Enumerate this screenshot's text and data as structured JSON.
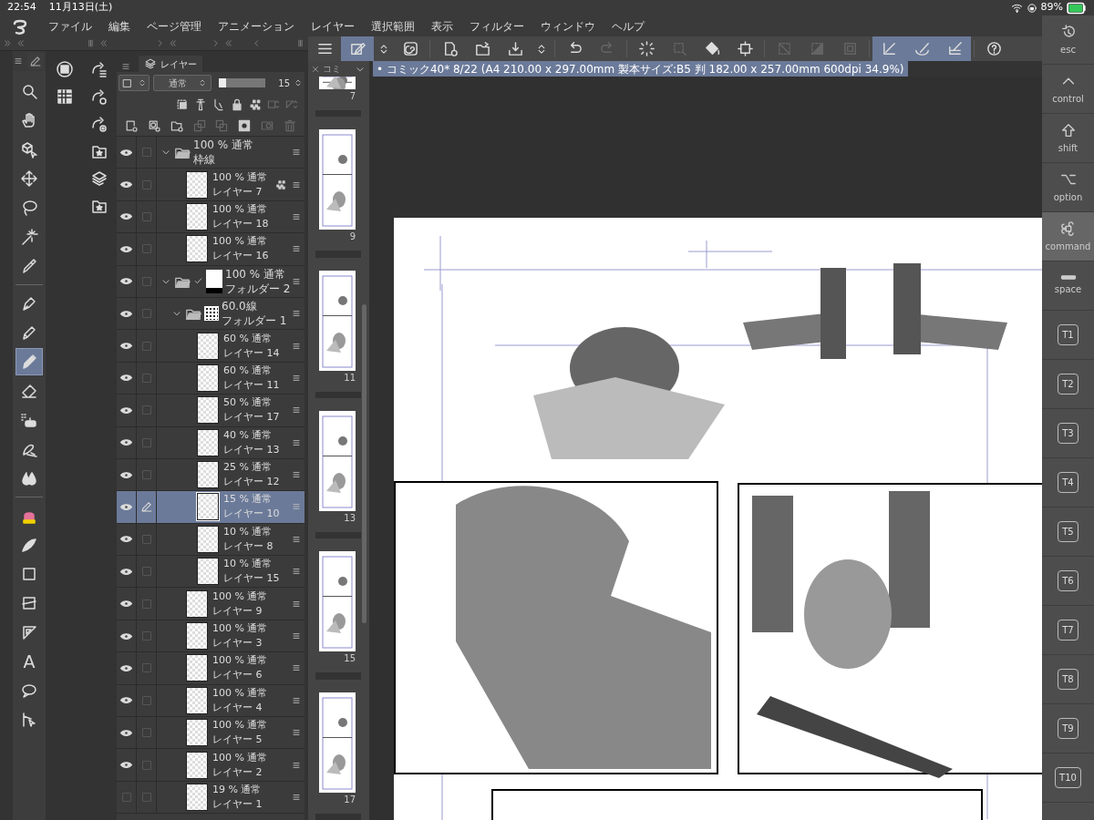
{
  "status_bar": {
    "time": "22:54",
    "date": "11月13日(土)",
    "battery": "89%"
  },
  "menu": [
    "ファイル",
    "編集",
    "ページ管理",
    "アニメーション",
    "レイヤー",
    "選択範囲",
    "表示",
    "フィルター",
    "ウィンドウ",
    "ヘルプ"
  ],
  "command_bar": [
    {
      "kind": "menu",
      "selected": false,
      "disabled": false
    },
    {
      "kind": "pen-box",
      "selected": true,
      "disabled": false
    },
    {
      "kind": "updown",
      "selected": false,
      "disabled": false
    },
    {
      "kind": "swirl",
      "selected": false,
      "disabled": false
    },
    {
      "kind": "new-page",
      "selected": false,
      "disabled": false
    },
    {
      "kind": "folder-open",
      "selected": false,
      "disabled": false
    },
    {
      "kind": "save",
      "selected": false,
      "disabled": false
    },
    {
      "kind": "updown",
      "selected": false,
      "disabled": false
    },
    {
      "kind": "undo",
      "selected": false,
      "disabled": false
    },
    {
      "kind": "redo",
      "selected": false,
      "disabled": true
    },
    {
      "kind": "spinner",
      "selected": false,
      "disabled": false
    },
    {
      "kind": "crop",
      "selected": false,
      "disabled": true
    },
    {
      "kind": "bucket",
      "selected": false,
      "disabled": false
    },
    {
      "kind": "transform",
      "selected": false,
      "disabled": false
    },
    {
      "kind": "clear",
      "selected": false,
      "disabled": true
    },
    {
      "kind": "fill-half",
      "selected": false,
      "disabled": true
    },
    {
      "kind": "frame-square",
      "selected": false,
      "disabled": true
    },
    {
      "kind": "ruler-snap",
      "selected": true,
      "disabled": false
    },
    {
      "kind": "curve-snap",
      "selected": true,
      "disabled": false
    },
    {
      "kind": "grid-snap",
      "selected": true,
      "disabled": false
    },
    {
      "kind": "help",
      "selected": false,
      "disabled": false
    }
  ],
  "tool_groups": [
    [
      {
        "kind": "magnifier",
        "selected": false
      },
      {
        "kind": "hand",
        "selected": false
      },
      {
        "kind": "cube-cursor",
        "selected": false
      },
      {
        "kind": "move-arrows",
        "selected": false
      },
      {
        "kind": "lasso",
        "selected": false
      },
      {
        "kind": "sparkle",
        "selected": false
      },
      {
        "kind": "dropper",
        "selected": false
      }
    ],
    [
      {
        "kind": "pen-nib",
        "selected": false
      },
      {
        "kind": "pen",
        "selected": false
      },
      {
        "kind": "marker",
        "selected": true
      },
      {
        "kind": "eraser",
        "selected": false
      },
      {
        "kind": "spray",
        "selected": false
      },
      {
        "kind": "blend",
        "selected": false
      },
      {
        "kind": "drops",
        "selected": false
      }
    ],
    [
      {
        "kind": "cake",
        "selected": false
      },
      {
        "kind": "curve",
        "selected": false
      },
      {
        "kind": "square",
        "selected": false
      },
      {
        "kind": "frame",
        "selected": false
      },
      {
        "kind": "triangle",
        "selected": false
      },
      {
        "kind": "text",
        "glyph": "A",
        "selected": false
      },
      {
        "kind": "balloon",
        "selected": false
      },
      {
        "kind": "line-cursor",
        "selected": false
      }
    ]
  ],
  "side_panels": [
    [
      {
        "kind": "circle-square"
      },
      {
        "kind": "grid"
      }
    ],
    [
      {
        "kind": "share-list"
      },
      {
        "kind": "share-gear"
      },
      {
        "kind": "share-target"
      },
      {
        "kind": "star-folder"
      },
      {
        "kind": "layers-stack"
      },
      {
        "kind": "star-folder"
      }
    ]
  ],
  "layer_panel": {
    "tab": "レイヤー",
    "blend_mode": "通常",
    "opacity": "15",
    "opacity_slider": {
      "level": 0.15
    },
    "tool_rows": [
      [
        {
          "kind": "dash-square",
          "disabled": false
        },
        {
          "kind": "lighthouse",
          "disabled": false
        },
        {
          "kind": "clip",
          "disabled": false
        },
        {
          "kind": "lock",
          "disabled": false
        },
        {
          "kind": "checker-lock",
          "disabled": false
        },
        {
          "kind": "mask-updown",
          "disabled": true
        },
        {
          "kind": "tri-updown",
          "disabled": true
        }
      ],
      [
        {
          "kind": "new-layer",
          "disabled": false
        },
        {
          "kind": "new-vector",
          "disabled": false
        },
        {
          "kind": "new-folder",
          "disabled": false
        },
        {
          "kind": "copy-up",
          "disabled": true
        },
        {
          "kind": "copy-down",
          "disabled": true
        },
        {
          "kind": "mask",
          "disabled": false
        },
        {
          "kind": "mask-link",
          "disabled": true
        },
        {
          "kind": "trash",
          "disabled": true
        }
      ]
    ],
    "layers": [
      {
        "kind": "folder",
        "mode": "100 % 通常",
        "name": "枠線",
        "visible": true,
        "selected": false,
        "editing": false,
        "expanded": true,
        "children": [
          {
            "kind": "layer",
            "mode": "100 % 通常",
            "name": "レイヤー 7",
            "visible": true,
            "selected": false,
            "editing": false,
            "locked": true
          },
          {
            "kind": "layer",
            "mode": "100 % 通常",
            "name": "レイヤー 18",
            "visible": true,
            "selected": false,
            "editing": false,
            "locked": false
          },
          {
            "kind": "layer",
            "mode": "100 % 通常",
            "name": "レイヤー 16",
            "visible": true,
            "selected": false,
            "editing": false,
            "locked": false
          }
        ]
      },
      {
        "kind": "folder",
        "thumbnail": {
          "kind": "mask"
        },
        "mode": "100 % 通常",
        "name": "フォルダー 2",
        "visible": true,
        "selected": false,
        "editing": false,
        "expanded": true,
        "children": [
          {
            "kind": "folder",
            "thumbnail": {
              "kind": "tone"
            },
            "mode": "60.0線",
            "name": "フォルダー 1",
            "visible": true,
            "selected": false,
            "editing": false,
            "expanded": true,
            "children": [
              {
                "kind": "layer",
                "mode": "60 % 通常",
                "name": "レイヤー 14",
                "visible": true,
                "selected": false,
                "editing": false,
                "locked": false
              },
              {
                "kind": "layer",
                "mode": "60 % 通常",
                "name": "レイヤー 11",
                "visible": true,
                "selected": false,
                "editing": false,
                "locked": false
              },
              {
                "kind": "layer",
                "mode": "50 % 通常",
                "name": "レイヤー 17",
                "visible": true,
                "selected": false,
                "editing": false,
                "locked": false
              },
              {
                "kind": "layer",
                "mode": "40 % 通常",
                "name": "レイヤー 13",
                "visible": true,
                "selected": false,
                "editing": false,
                "locked": false
              },
              {
                "kind": "layer",
                "mode": "25 % 通常",
                "name": "レイヤー 12",
                "visible": true,
                "selected": false,
                "editing": false,
                "locked": false
              },
              {
                "kind": "layer",
                "mode": "15 % 通常",
                "name": "レイヤー 10",
                "visible": true,
                "selected": true,
                "editing": true,
                "locked": false
              },
              {
                "kind": "layer",
                "mode": "10 % 通常",
                "name": "レイヤー 8",
                "visible": true,
                "selected": false,
                "editing": false,
                "locked": false
              },
              {
                "kind": "layer",
                "mode": "10 % 通常",
                "name": "レイヤー 15",
                "visible": true,
                "selected": false,
                "editing": false,
                "locked": false
              }
            ]
          },
          {
            "kind": "layer",
            "mode": "100 % 通常",
            "name": "レイヤー 9",
            "visible": true,
            "selected": false,
            "editing": false,
            "locked": false
          },
          {
            "kind": "layer",
            "mode": "100 % 通常",
            "name": "レイヤー 3",
            "visible": true,
            "selected": false,
            "editing": false,
            "locked": false
          },
          {
            "kind": "layer",
            "mode": "100 % 通常",
            "name": "レイヤー 6",
            "visible": true,
            "selected": false,
            "editing": false,
            "locked": false
          },
          {
            "kind": "layer",
            "mode": "100 % 通常",
            "name": "レイヤー 4",
            "visible": true,
            "selected": false,
            "editing": false,
            "locked": false
          },
          {
            "kind": "layer",
            "mode": "100 % 通常",
            "name": "レイヤー 5",
            "visible": true,
            "selected": false,
            "editing": false,
            "locked": false
          },
          {
            "kind": "layer",
            "mode": "100 % 通常",
            "name": "レイヤー 2",
            "visible": true,
            "selected": false,
            "editing": false,
            "locked": false
          },
          {
            "kind": "layer",
            "mode": "19 % 通常",
            "name": "レイヤー 1",
            "visible": false,
            "selected": false,
            "editing": false,
            "locked": false
          }
        ]
      }
    ]
  },
  "pages": {
    "tab": "コミ",
    "thumbnails": [
      "7",
      "9",
      "11",
      "13",
      "15",
      "17"
    ]
  },
  "document": {
    "title": "• コミック40* 8/22 (A4 210.00 x 297.00mm 製本サイズ:B5 判 182.00 x 257.00mm 600dpi 34.9%)"
  },
  "keys": [
    {
      "kind": "esc",
      "label": "esc",
      "selected": false
    },
    {
      "kind": "control",
      "label": "control",
      "selected": false
    },
    {
      "kind": "shift",
      "label": "shift",
      "selected": false
    },
    {
      "kind": "option",
      "label": "option",
      "selected": false
    },
    {
      "kind": "command",
      "label": "command",
      "selected": true
    },
    {
      "kind": "space",
      "label": "space",
      "selected": false
    },
    {
      "kind": "tab",
      "label": "T1",
      "selected": false
    },
    {
      "kind": "tab",
      "label": "T2",
      "selected": false
    },
    {
      "kind": "tab",
      "label": "T3",
      "selected": false
    },
    {
      "kind": "tab",
      "label": "T4",
      "selected": false
    },
    {
      "kind": "tab",
      "label": "T5",
      "selected": false
    },
    {
      "kind": "tab",
      "label": "T6",
      "selected": false
    },
    {
      "kind": "tab",
      "label": "T7",
      "selected": false
    },
    {
      "kind": "tab",
      "label": "T8",
      "selected": false
    },
    {
      "kind": "tab",
      "label": "T9",
      "selected": false
    },
    {
      "kind": "tab",
      "label": "T10",
      "selected": false
    }
  ]
}
